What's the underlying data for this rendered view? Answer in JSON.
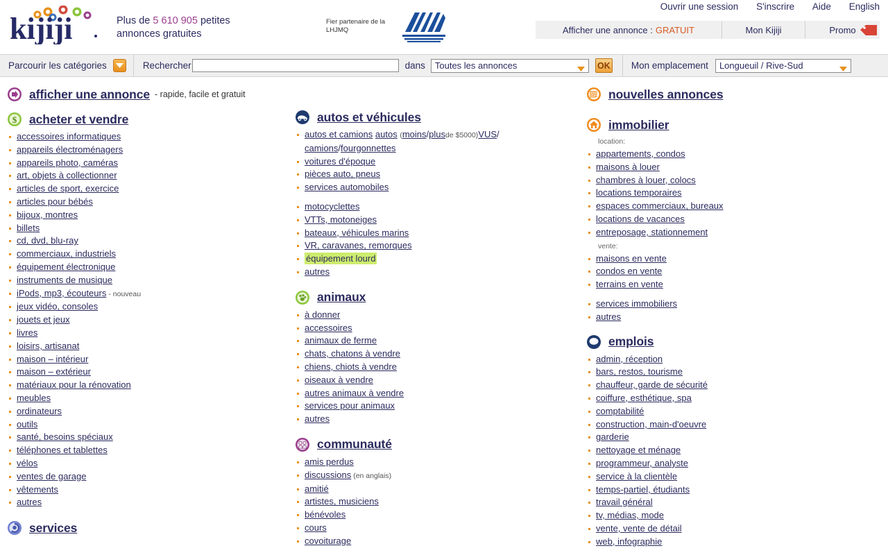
{
  "header": {
    "logo_alt": "kijiji",
    "tagline_prefix": "Plus de",
    "tagline_count": "5 610 905",
    "tagline_suffix": "petites annonces gratuites",
    "partner_text": "Fier partenaire de la LHJMQ",
    "partner_logo_alt": "LHJMQ",
    "links": [
      {
        "label": "Ouvrir une session"
      },
      {
        "label": "S'inscrire"
      },
      {
        "label": "Aide"
      },
      {
        "label": "English"
      }
    ],
    "tabs": {
      "post_prefix": "Afficher une annonce :",
      "post_free": "GRATUIT",
      "my_kijiji": "Mon Kijiji",
      "promo": "Promo"
    }
  },
  "search": {
    "browse_label": "Parcourir les catégories",
    "search_label": "Rechercher",
    "search_value": "",
    "search_placeholder": "",
    "in_label": "dans",
    "category_selected": "Toutes les annonces",
    "ok_label": "OK",
    "location_label": "Mon emplacement",
    "location_selected": "Longueuil / Rive-Sud"
  },
  "post_ad": {
    "title": "afficher une annonce",
    "subtitle": "- rapide, facile et gratuit"
  },
  "colors": {
    "accent_orange": "#e8911c",
    "link_navy": "#2b2b5f",
    "free_orange": "#d95b23",
    "highlight_green": "#cdec6e",
    "count_purple": "#9b3e8e"
  },
  "sections": {
    "acheter_et_vendre": {
      "title": "acheter et vendre",
      "icon": "dollar-circle-icon",
      "items": [
        {
          "label": "accessoires informatiques"
        },
        {
          "label": "appareils électroménagers"
        },
        {
          "label": "appareils photo, caméras"
        },
        {
          "label": "art, objets à collectionner"
        },
        {
          "label": "articles de sport, exercice"
        },
        {
          "label": "articles pour bébés"
        },
        {
          "label": "bijoux, montres"
        },
        {
          "label": "billets"
        },
        {
          "label": "cd, dvd, blu-ray"
        },
        {
          "label": "commerciaux, industriels"
        },
        {
          "label": "équipement électronique"
        },
        {
          "label": "instruments de musique"
        },
        {
          "label": "iPods, mp3, écouteurs",
          "note": "- nouveau"
        },
        {
          "label": "jeux vidéo, consoles"
        },
        {
          "label": "jouets et jeux"
        },
        {
          "label": "livres"
        },
        {
          "label": "loisirs, artisanat"
        },
        {
          "label": "maison – intérieur"
        },
        {
          "label": "maison – extérieur"
        },
        {
          "label": "matériaux pour la rénovation"
        },
        {
          "label": "meubles"
        },
        {
          "label": "ordinateurs"
        },
        {
          "label": "outils"
        },
        {
          "label": "santé, besoins spéciaux"
        },
        {
          "label": "téléphones et tablettes"
        },
        {
          "label": "vélos"
        },
        {
          "label": "ventes de garage"
        },
        {
          "label": "vêtements"
        },
        {
          "label": "autres"
        }
      ]
    },
    "services": {
      "title": "services",
      "icon": "services-swirl-icon",
      "items": []
    },
    "autos_et_vehicules": {
      "title": "autos et véhicules",
      "icon": "car-icon",
      "autos_line": {
        "main": "autos et camions",
        "autos": "autos",
        "open_paren": "(",
        "moins": "moins",
        "slash1": "/",
        "plus": "plus",
        "de_prix": "de $5000)",
        "vus": "VUS",
        "slash2": "/",
        "camions": "camions",
        "slash3": "/",
        "fourgonnettes": "fourgonnettes"
      },
      "items": [
        {
          "label": "voitures d'époque"
        },
        {
          "label": "pièces auto, pneus"
        },
        {
          "label": "services automobiles"
        },
        {
          "spacer": true
        },
        {
          "label": "motocyclettes"
        },
        {
          "label": "VTTs, motoneiges"
        },
        {
          "label": "bateaux, véhicules marins"
        },
        {
          "label": "VR, caravanes, remorques"
        },
        {
          "label": "équipement lourd",
          "highlight": true
        },
        {
          "label": "autres"
        }
      ]
    },
    "animaux": {
      "title": "animaux",
      "icon": "paw-icon",
      "items": [
        {
          "label": "à donner"
        },
        {
          "label": "accessoires"
        },
        {
          "label": "animaux de ferme"
        },
        {
          "label": "chats, chatons à vendre"
        },
        {
          "label": "chiens, chiots à vendre"
        },
        {
          "label": "oiseaux à vendre"
        },
        {
          "label": "autres animaux à vendre"
        },
        {
          "label": "services pour animaux"
        },
        {
          "label": "autres"
        }
      ]
    },
    "communaute": {
      "title": "communauté",
      "icon": "people-icon",
      "items": [
        {
          "label": "amis perdus"
        },
        {
          "label": "discussions",
          "note": "(en anglais)"
        },
        {
          "label": "amitié"
        },
        {
          "label": "artistes, musiciens"
        },
        {
          "label": "bénévoles"
        },
        {
          "label": "cours"
        },
        {
          "label": "covoiturage"
        }
      ]
    },
    "nouvelles_annonces": {
      "title": "nouvelles annonces",
      "icon": "new-ads-icon",
      "items": []
    },
    "immobilier": {
      "title": "immobilier",
      "icon": "house-icon",
      "group_location": "location:",
      "group_vente": "vente:",
      "location_items": [
        {
          "label": "appartements, condos"
        },
        {
          "label": "maisons à louer"
        },
        {
          "label": "chambres à louer, colocs"
        },
        {
          "label": "locations temporaires"
        },
        {
          "label": "espaces commerciaux, bureaux"
        },
        {
          "label": "locations de vacances"
        },
        {
          "label": "entreposage, stationnement"
        }
      ],
      "vente_items": [
        {
          "label": "maisons en vente"
        },
        {
          "label": "condos en vente"
        },
        {
          "label": "terrains en vente"
        }
      ],
      "other_items": [
        {
          "label": "services immobiliers"
        },
        {
          "label": "autres"
        }
      ]
    },
    "emplois": {
      "title": "emplois",
      "icon": "briefcase-sphere-icon",
      "items": [
        {
          "label": "admin, réception"
        },
        {
          "label": "bars, restos, tourisme"
        },
        {
          "label": "chauffeur, garde de sécurité"
        },
        {
          "label": "coiffure, esthétique, spa"
        },
        {
          "label": "comptabilité"
        },
        {
          "label": "construction, main-d'oeuvre"
        },
        {
          "label": "garderie"
        },
        {
          "label": "nettoyage et ménage"
        },
        {
          "label": "programmeur, analyste"
        },
        {
          "label": "service à la clientèle"
        },
        {
          "label": "temps-partiel, étudiants"
        },
        {
          "label": "travail général"
        },
        {
          "label": "tv, médias, mode"
        },
        {
          "label": "vente, vente de détail"
        },
        {
          "label": "web, infographie"
        }
      ]
    }
  }
}
